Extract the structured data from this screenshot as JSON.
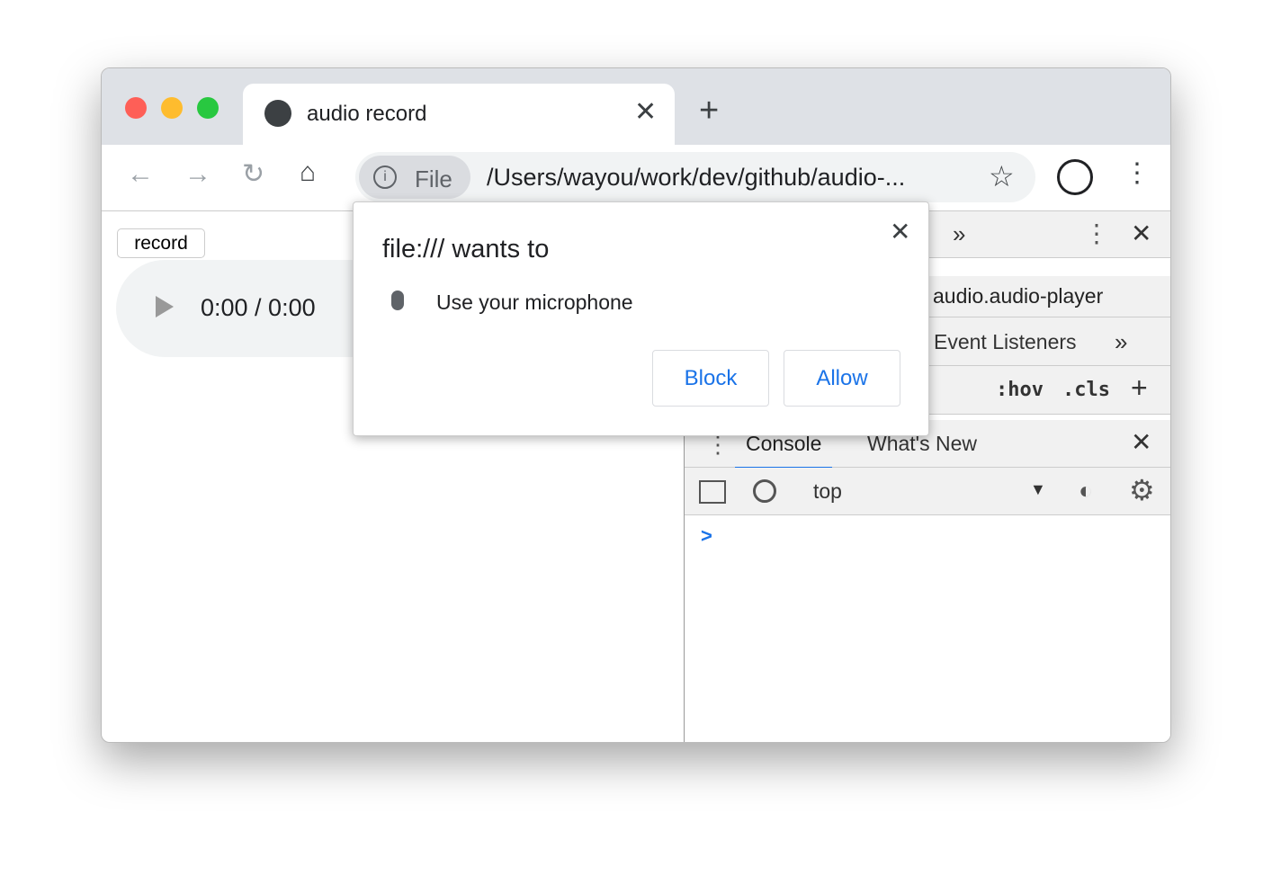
{
  "tab": {
    "title": "audio record",
    "icon": "globe-icon"
  },
  "omnibox": {
    "chip": "File",
    "url": "/Users/wayou/work/dev/github/audio-..."
  },
  "page": {
    "record_button": "record",
    "player_time": "0:00 / 0:00"
  },
  "popup": {
    "title": "file:/// wants to",
    "permission": "Use your microphone",
    "block": "Block",
    "allow": "Allow"
  },
  "devtools": {
    "element": "audio.audio-player",
    "event_listeners": "Event Listeners",
    "hov": ":hov",
    "cls": ".cls",
    "drawer_tabs": [
      "Console",
      "What's New"
    ],
    "context": "top",
    "prompt": ">"
  },
  "colors": {
    "accent": "#1a73e8",
    "close_red": "#fe5f57",
    "minimize_yellow": "#febc2e",
    "zoom_green": "#28c840"
  }
}
